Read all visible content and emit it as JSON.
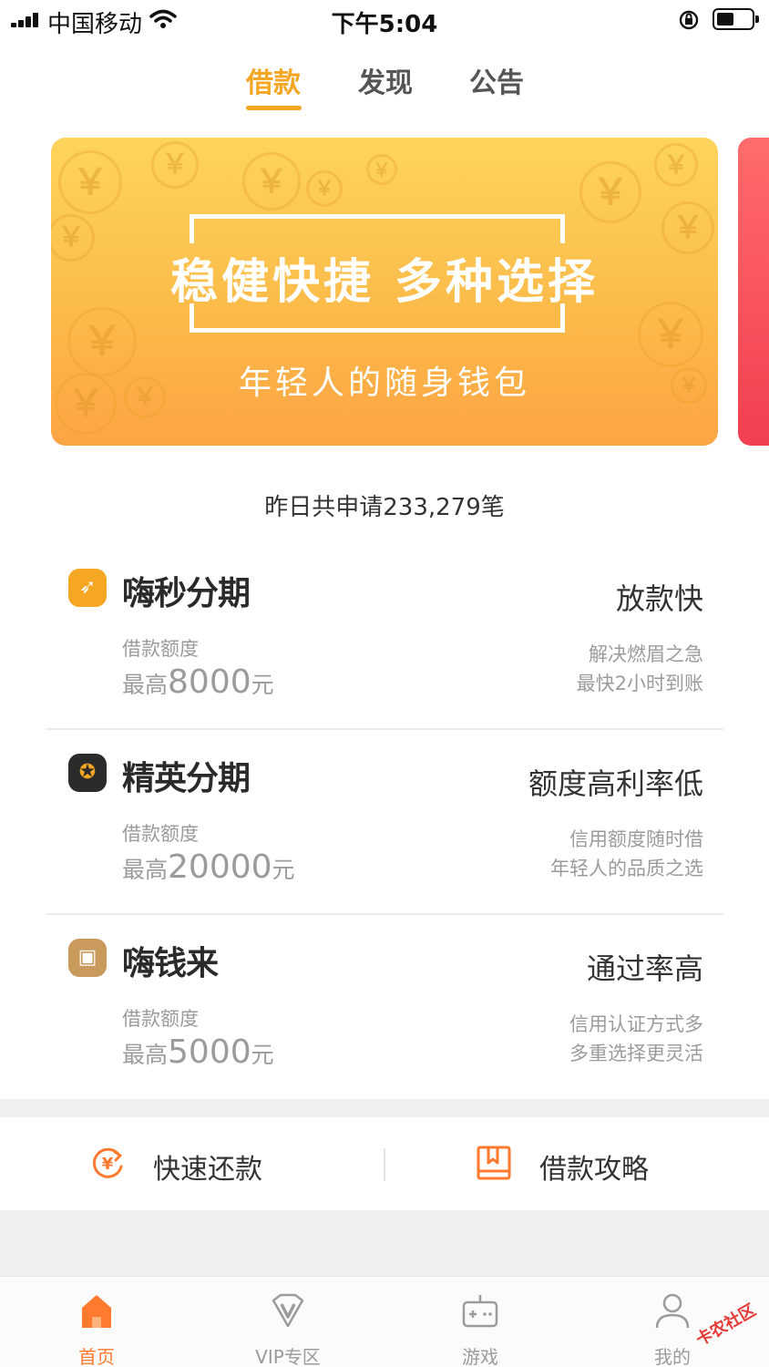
{
  "status_bar": {
    "carrier": "中国移动",
    "time": "下午5:04"
  },
  "top_tabs": [
    {
      "label": "借款",
      "active": true
    },
    {
      "label": "发现",
      "active": false
    },
    {
      "label": "公告",
      "active": false
    }
  ],
  "banner": {
    "headline": "稳健快捷  多种选择",
    "subline": "年轻人的随身钱包",
    "coin_symbol": "￥"
  },
  "stats": "昨日共申请233,279笔",
  "products": [
    {
      "icon": "rocket-icon",
      "icon_color": "#f5a623",
      "name": "嗨秒分期",
      "limit_label": "借款额度",
      "limit_prefix": "最高",
      "limit_amount": "8000",
      "limit_suffix": "元",
      "feature": "放款快",
      "desc1": "解决燃眉之急",
      "desc2": "最快2小时到账"
    },
    {
      "icon": "medal-icon",
      "icon_color": "#2b2b2b",
      "name": "精英分期",
      "limit_label": "借款额度",
      "limit_prefix": "最高",
      "limit_amount": "20000",
      "limit_suffix": "元",
      "feature": "额度高利率低",
      "desc1": "信用额度随时借",
      "desc2": "年轻人的品质之选"
    },
    {
      "icon": "wallet-icon",
      "icon_color": "#c99a5b",
      "name": "嗨钱来",
      "limit_label": "借款额度",
      "limit_prefix": "最高",
      "limit_amount": "5000",
      "limit_suffix": "元",
      "feature": "通过率高",
      "desc1": "信用认证方式多",
      "desc2": "多重选择更灵活"
    }
  ],
  "quick_actions": [
    {
      "label": "快速还款",
      "icon": "repay-icon"
    },
    {
      "label": "借款攻略",
      "icon": "guide-book-icon"
    }
  ],
  "bottom_nav": [
    {
      "label": "首页",
      "icon": "home-icon",
      "active": true
    },
    {
      "label": "VIP专区",
      "icon": "vip-icon",
      "active": false
    },
    {
      "label": "游戏",
      "icon": "gamepad-icon",
      "active": false
    },
    {
      "label": "我的",
      "icon": "user-icon",
      "active": false
    }
  ],
  "watermark": "卡农社区",
  "colors": {
    "accent": "#f5a623",
    "nav_active": "#ff7a2e",
    "muted_text": "#9b9b9b"
  }
}
